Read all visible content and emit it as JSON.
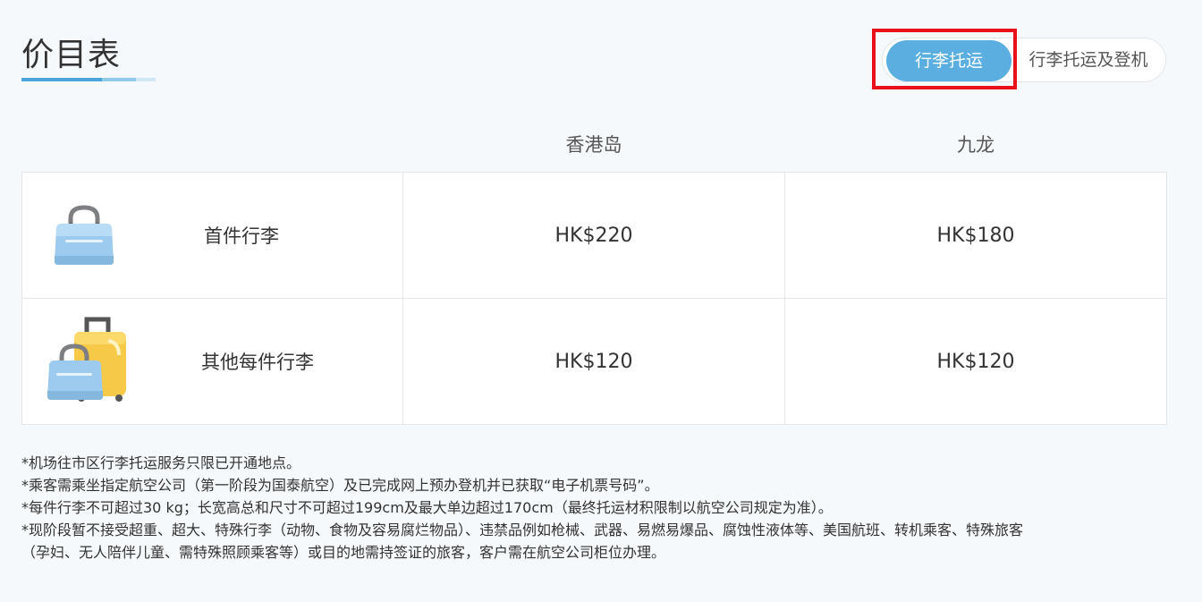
{
  "page": {
    "title": "价目表"
  },
  "toggle": {
    "active_label": "行李托运",
    "inactive_label": "行李托运及登机"
  },
  "table": {
    "columns": [
      "香港岛",
      "九龙"
    ],
    "rows": [
      {
        "item": "首件行李",
        "icon": "handbag-icon",
        "prices": [
          "HK$220",
          "HK$180"
        ]
      },
      {
        "item": "其他每件行李",
        "icon": "luggage-icon",
        "prices": [
          "HK$120",
          "HK$120"
        ]
      }
    ]
  },
  "notes": [
    "*机场往市区行李托运服务只限已开通地点。",
    "*乘客需乘坐指定航空公司（第一阶段为国泰航空）及已完成网上预办登机并已获取“电子机票号码”。",
    "*每件行李不可超过30 kg；长宽高总和尺寸不可超过199cm及最大单边超过170cm（最终托运材积限制以航空公司规定为准）。",
    "*现阶段暂不接受超重、超大、特殊行李（动物、食物及容易腐烂物品）、违禁品例如枪械、武器、易燃易爆品、腐蚀性液体等、美国航班、转机乘客、特殊旅客",
    "（孕妇、无人陪伴儿童、需特殊照顾乘客等）或目的地需持签证的旅客，客户需在航空公司柜位办理。"
  ],
  "colors": {
    "accent": "#5aaee0",
    "highlight": "#e8101a"
  }
}
